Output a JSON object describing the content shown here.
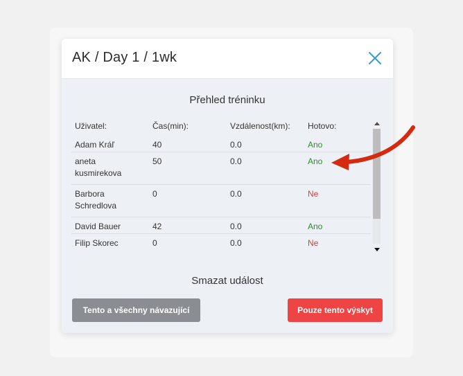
{
  "modal": {
    "title": "AK / Day 1 / 1wk",
    "close_icon": "close-icon"
  },
  "overview": {
    "title": "Přehled tréninku",
    "columns": [
      "Uživatel:",
      "Čas(min):",
      "Vzdálenost(km):",
      "Hotovo:"
    ],
    "rows": [
      {
        "user": "Adam Kráľ",
        "time": "40",
        "distance": "0.0",
        "done": "Ano"
      },
      {
        "user": "aneta kusmirekova",
        "time": "50",
        "distance": "0.0",
        "done": "Ano"
      },
      {
        "user": "Barbora Schredlova",
        "time": "0",
        "distance": "0.0",
        "done": "Ne"
      },
      {
        "user": "David Bauer",
        "time": "42",
        "distance": "0.0",
        "done": "Ano"
      },
      {
        "user": "Filip Skorec",
        "time": "0",
        "distance": "0.0",
        "done": "Ne"
      }
    ]
  },
  "delete": {
    "title": "Smazat událost",
    "all_label": "Tento a všechny návazující",
    "only_label": "Pouze tento výskyt"
  },
  "colors": {
    "accent": "#3a9bd5",
    "yes": "#2e8b2e",
    "no": "#e53935",
    "danger": "#ef4444",
    "secondary": "#8a8d91",
    "annotation_arrow": "#d42a10"
  }
}
